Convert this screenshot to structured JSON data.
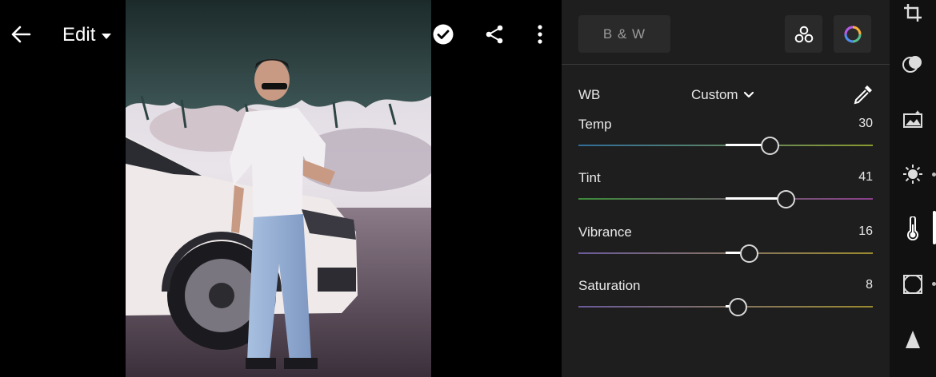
{
  "header": {
    "back_icon": "arrow-left-icon",
    "mode_label": "Edit",
    "history_icon": "history-icon",
    "help_icon": "help-icon",
    "done_icon": "checkmark-icon",
    "share_icon": "share-icon",
    "more_icon": "more-vertical-icon"
  },
  "panel": {
    "bw_label": "B & W",
    "mix_icon": "color-mix-icon",
    "color_grading_icon": "color-wheel-icon",
    "wb": {
      "label": "WB",
      "selected": "Custom",
      "picker_icon": "eyedropper-icon"
    },
    "sliders": [
      {
        "key": "temp",
        "label": "Temp",
        "value": "30",
        "min": -100,
        "max": 100,
        "track": [
          "#2f6d9a",
          "#8a9a2e"
        ]
      },
      {
        "key": "tint",
        "label": "Tint",
        "value": "41",
        "min": -100,
        "max": 100,
        "track": [
          "#3d8a3a",
          "#8a3f8a"
        ]
      },
      {
        "key": "vibrance",
        "label": "Vibrance",
        "value": "16",
        "min": -100,
        "max": 100,
        "track": [
          "#6a5a9a",
          "#9a8a2e"
        ]
      },
      {
        "key": "saturation",
        "label": "Saturation",
        "value": "8",
        "min": -100,
        "max": 100,
        "track": [
          "#6a5a9a",
          "#9a8a2e"
        ]
      }
    ]
  },
  "rail": [
    {
      "icon": "crop-icon"
    },
    {
      "icon": "mask-icon"
    },
    {
      "icon": "auto-enhance-icon"
    },
    {
      "icon": "light-icon"
    },
    {
      "icon": "color-temperature-icon",
      "active": true
    },
    {
      "icon": "optics-vignette-icon"
    },
    {
      "icon": "geometry-icon"
    }
  ],
  "colors": {
    "panel_bg": "#1e1e1e",
    "rail_bg": "#111111",
    "accent": "#ffffff"
  }
}
